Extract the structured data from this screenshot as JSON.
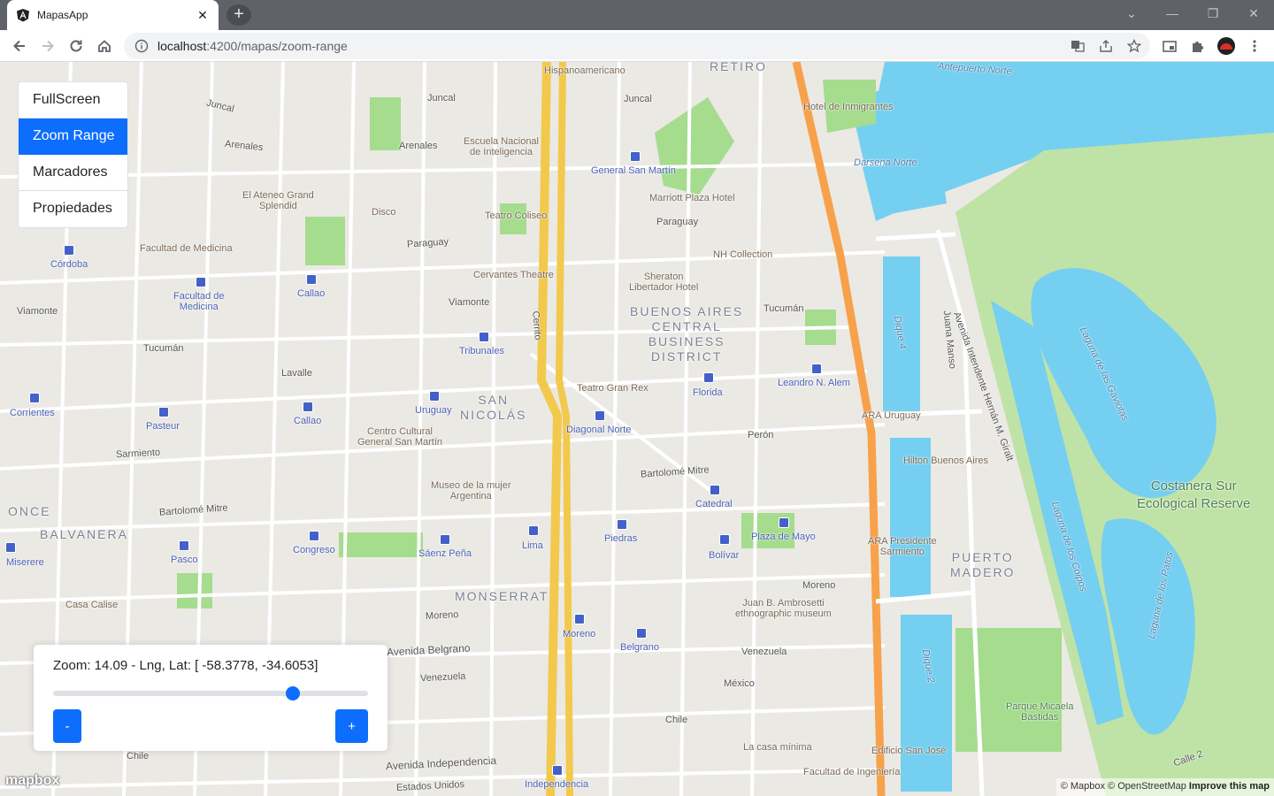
{
  "browser": {
    "tab_title": "MapasApp",
    "tab_close": "✕",
    "new_tab": "+",
    "url_host": "localhost",
    "url_path": ":4200/mapas/zoom-range",
    "win_min": "—",
    "win_restore": "❐",
    "win_close": "✕",
    "chevron": "⌄"
  },
  "menu": {
    "items": [
      {
        "label": "FullScreen"
      },
      {
        "label": "Zoom Range"
      },
      {
        "label": "Marcadores"
      },
      {
        "label": "Propiedades"
      }
    ],
    "active_index": 1
  },
  "zoom_panel": {
    "info": "Zoom: 14.09 - Lng, Lat: [ -58.3778, -34.6053]",
    "slider_fraction": 0.76,
    "minus_label": "-",
    "plus_label": "+"
  },
  "map": {
    "colors": {
      "water": "#75cff0",
      "park": "#a5dc8e",
      "land": "#ebe9e4",
      "highway": "#f7a14a",
      "primary": "#f2c94c"
    },
    "labels": {
      "hispanoamericano": "Hispanoamericano",
      "retiro": "RETIRO",
      "antepuerto": "Antepuerto Norte",
      "juncal1": "Juncal",
      "juncal2": "Juncal",
      "juncal3": "Juncal",
      "arenales1": "Arenales",
      "arenales2": "Arenales",
      "escuela": "Escuela Nacional\nde Inteligencia",
      "gral_san_martin": "General San Martín",
      "hotel_inmigrantes": "Hotel de Inmigrantes",
      "darsena": "Dársena Norte",
      "marriott": "Marriott Plaza Hotel",
      "ateneo": "El Ateneo Grand\nSplendid",
      "disco": "Disco",
      "coliseo": "Teatro Coliseo",
      "paraguay1": "Paraguay",
      "paraguay2": "Paraguay",
      "nh": "NH Collection",
      "fac_medicina": "Facultad de Medicina",
      "cordoba": "Córdoba",
      "fac_medicina_st": "Facultad de\nMedicina",
      "callao1": "Callao",
      "cervantes": "Cervantes Theatre",
      "sheraton": "Sheraton\nLibertador Hotel",
      "viamonte1": "Viamonte",
      "viamonte2": "Viamonte",
      "bacd": "BUENOS AIRES\nCENTRAL\nBUSINESS\nDISTRICT",
      "tucuman1": "Tucumán",
      "tucuman2": "Tucumán",
      "tribunales": "Tribunales",
      "lavalle": "Lavalle",
      "teatro_gran_rex": "Teatro Gran Rex",
      "florida_st": "Florida",
      "leandro_alem": "Leandro N. Alem",
      "san_nicolas": "SAN\nNICOLÁS",
      "uruguay_st": "Uruguay",
      "corrientes": "Corrientes",
      "pasteur": "Pasteur",
      "callao2": "Callao",
      "centro_cultural": "Centro Cultural\nGeneral San Martín",
      "diagonal_norte": "Diagonal Norte",
      "peron": "Perón",
      "ara_uruguay": "ARA Uruguay",
      "sarmiento": "Sarmiento",
      "hilton": "Hilton Buenos Aires",
      "museo_mujer": "Museo de la mujer\nArgentina",
      "bartolome1": "Bartolomé Mitre",
      "bartolome2": "Bartolomé Mitre",
      "catedral": "Catedral",
      "costanera": "Costanera Sur\nEcological Reserve",
      "once": "ONCE",
      "balvanera": "BALVANERA",
      "congreso": "Congreso",
      "saenz_pena": "Sáenz Peña",
      "lima": "Lima",
      "piedras_st": "Piedras",
      "bolivar": "Bolívar",
      "plaza_mayo": "Plaza de Mayo",
      "ara_sarmiento": "ARA Presidente\nSarmiento",
      "puerto_madero": "PUERTO\nMADERO",
      "miserere": "Miserere",
      "pasco": "Pasco",
      "casa_calise": "Casa Calise",
      "monserrat": "MONSERRAT",
      "moreno1": "Moreno",
      "moreno2": "Moreno",
      "moreno_st": "Moreno",
      "ambrosetti": "Juan B. Ambrosetti\nethnographic museum",
      "belgrano_st": "Belgrano",
      "av_belgrano": "Avenida Belgrano",
      "venezuela1": "Venezuela",
      "venezuela2": "Venezuela",
      "mexico": "México",
      "chile1": "Chile",
      "chile2": "Chile",
      "chile3": "Calle 2",
      "parque_micaela": "Parque Micaela\nBastidas",
      "casa_minima": "La casa mínima",
      "edificio": "Edificio San José",
      "fac_ingenieria": "Facultad de Ingeniería",
      "av_independencia": "Avenida Independencia",
      "independencia_st": "Independencia",
      "estados_unidos": "Estados Unidos",
      "dique4": "Dique 4",
      "dique2": "Dique 2",
      "gaviotas": "Laguna de las Gaviotas",
      "coipos": "Laguna de los Coipos",
      "patos": "Laguna de los Patos",
      "juana_manso": "Juana Manso",
      "giralt": "Avenida Intendente Hernán M. Giralt",
      "cerrito": "Cerrito"
    }
  },
  "mapbox_logo": "mapbox",
  "attribution": {
    "text": "© Mapbox © OpenStreetMap",
    "improve": "Improve this map"
  }
}
